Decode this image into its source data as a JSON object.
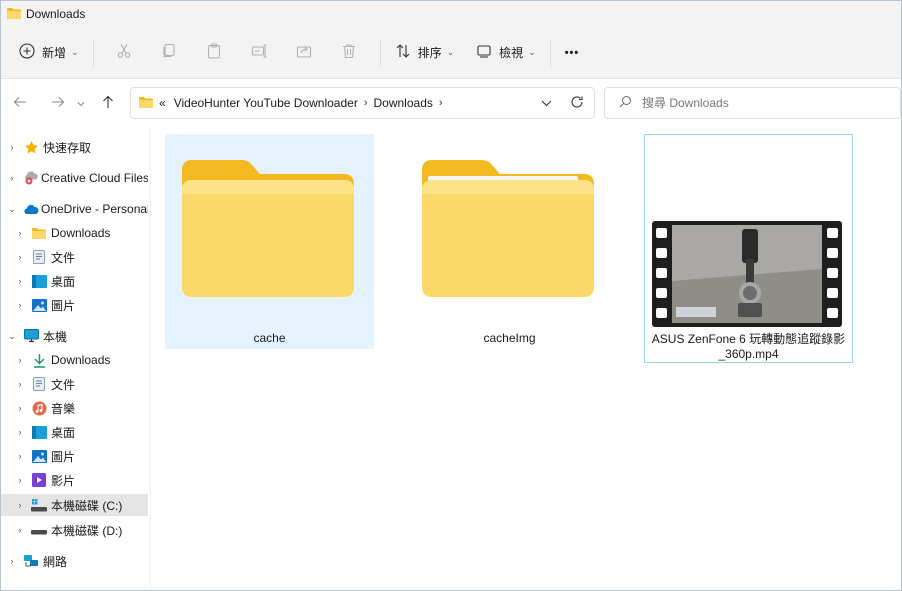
{
  "window": {
    "title": "Downloads"
  },
  "toolbar": {
    "new_label": "新增",
    "sort_label": "排序",
    "view_label": "檢視",
    "more_label": "•••"
  },
  "address": {
    "overflow": "«",
    "breadcrumbs": [
      "VideoHunter YouTube Downloader",
      "Downloads"
    ],
    "search_placeholder": "搜尋 Downloads"
  },
  "nav": {
    "items": [
      {
        "label": "快速存取",
        "icon": "star-icon"
      },
      {
        "label": "Creative Cloud Files",
        "icon": "creative-cloud-icon"
      },
      {
        "label": "OneDrive - Personal",
        "icon": "onedrive-cloud-icon"
      },
      {
        "label": "Downloads",
        "icon": "folder-icon"
      },
      {
        "label": "文件",
        "icon": "documents-icon"
      },
      {
        "label": "桌面",
        "icon": "desktop-icon"
      },
      {
        "label": "圖片",
        "icon": "pictures-icon"
      },
      {
        "label": "本機",
        "icon": "this-pc-icon"
      },
      {
        "label": "Downloads",
        "icon": "download-arrow-icon"
      },
      {
        "label": "文件",
        "icon": "documents-icon"
      },
      {
        "label": "音樂",
        "icon": "music-icon"
      },
      {
        "label": "桌面",
        "icon": "desktop-icon"
      },
      {
        "label": "圖片",
        "icon": "pictures-icon"
      },
      {
        "label": "影片",
        "icon": "videos-icon"
      },
      {
        "label": "本機磁碟 (C:)",
        "icon": "drive-c-icon"
      },
      {
        "label": "本機磁碟 (D:)",
        "icon": "drive-d-icon"
      },
      {
        "label": "網路",
        "icon": "network-icon"
      }
    ]
  },
  "files": [
    {
      "name": "cache",
      "type": "folder"
    },
    {
      "name": "cacheImg",
      "type": "folder"
    },
    {
      "name": "ASUS ZenFone 6 玩轉動態追蹤錄影_360p.mp4",
      "name_line1": "ASUS ZenFone 6 玩轉動態追蹤錄影",
      "name_line2": "_360p.mp4",
      "type": "video"
    }
  ],
  "colors": {
    "folder_back": "#f3b921",
    "folder_front": "#fcd86a",
    "selected_tile": "#e5f3ff",
    "selected_nav": "#e5e5e5",
    "accent": "#0067c0"
  }
}
